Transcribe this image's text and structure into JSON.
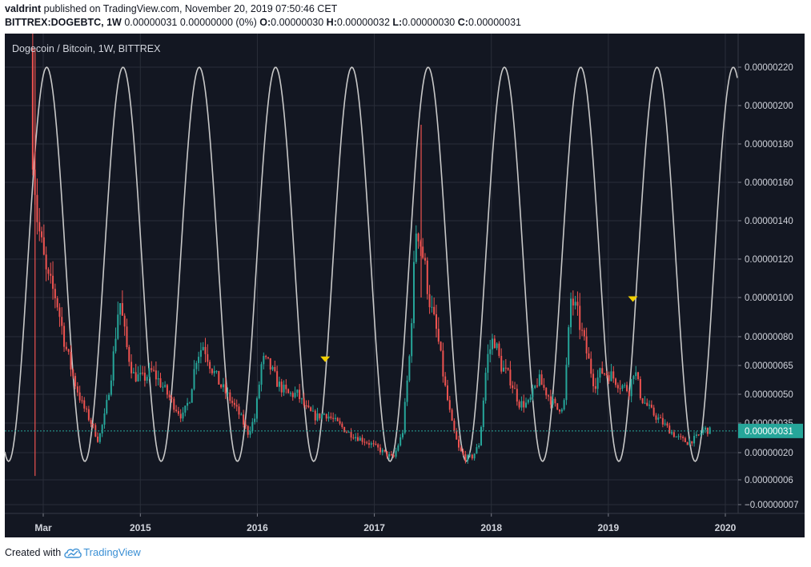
{
  "header": {
    "author": "valdrint",
    "published_text": "published on TradingView.com, November 20, 2019 07:50:46 CET",
    "symbol": "BITTREX:DOGEBTC",
    "interval": ", 1W",
    "last": "0.00000031",
    "change": "0.00000000 (0%)",
    "o_label": "O:",
    "o_value": "0.00000030",
    "h_label": "H:",
    "h_value": "0.00000032",
    "l_label": "L:",
    "l_value": "0.00000030",
    "c_label": "C:",
    "c_value": "0.00000031"
  },
  "footer": {
    "created_with": "Created with",
    "brand": "TradingView"
  },
  "colors": {
    "background": "#131722",
    "grid": "#2a2e39",
    "up": "#26a69a",
    "down": "#ef5350",
    "cycle": "#c8c8c8",
    "marker": "#f2d000",
    "price_label": "#26a69a"
  },
  "chart_data": {
    "type": "candlestick",
    "title": "Dogecoin / Bitcoin, 1W, BITTREX",
    "x_start": "2014-02",
    "x_end": "2020-01",
    "x_ticks": [
      {
        "label": "Mar",
        "t": 2014.17
      },
      {
        "label": "2015",
        "t": 2015.0
      },
      {
        "label": "2016",
        "t": 2016.0
      },
      {
        "label": "2017",
        "t": 2017.0
      },
      {
        "label": "2018",
        "t": 2018.0
      },
      {
        "label": "2019",
        "t": 2019.0
      },
      {
        "label": "2020",
        "t": 2020.0
      }
    ],
    "y_ticks": [
      {
        "label": "0.00000220",
        "v": 220
      },
      {
        "label": "0.00000200",
        "v": 200
      },
      {
        "label": "0.00000180",
        "v": 180
      },
      {
        "label": "0.00000160",
        "v": 160
      },
      {
        "label": "0.00000140",
        "v": 140
      },
      {
        "label": "0.00000120",
        "v": 120
      },
      {
        "label": "0.00000100",
        "v": 100
      },
      {
        "label": "0.00000080",
        "v": 80
      },
      {
        "label": "0.00000065",
        "v": 65
      },
      {
        "label": "0.00000050",
        "v": 50
      },
      {
        "label": "0.00000035",
        "v": 35
      },
      {
        "label": "0.00000020",
        "v": 20
      },
      {
        "label": "0.00000006",
        "v": 6
      },
      {
        "label": "−0.00000007",
        "v": -7
      }
    ],
    "last_price": {
      "label": "0.00000031",
      "v": 31
    },
    "price_path": [
      [
        2014.08,
        230
      ],
      [
        2014.1,
        175
      ],
      [
        2014.14,
        140
      ],
      [
        2014.18,
        125
      ],
      [
        2014.22,
        110
      ],
      [
        2014.3,
        100
      ],
      [
        2014.38,
        75
      ],
      [
        2014.45,
        58
      ],
      [
        2014.52,
        45
      ],
      [
        2014.6,
        35
      ],
      [
        2014.66,
        26
      ],
      [
        2014.72,
        40
      ],
      [
        2014.78,
        65
      ],
      [
        2014.84,
        100
      ],
      [
        2014.9,
        75
      ],
      [
        2014.96,
        60
      ],
      [
        2015.04,
        58
      ],
      [
        2015.12,
        62
      ],
      [
        2015.2,
        55
      ],
      [
        2015.3,
        45
      ],
      [
        2015.38,
        38
      ],
      [
        2015.44,
        48
      ],
      [
        2015.5,
        70
      ],
      [
        2015.56,
        76
      ],
      [
        2015.62,
        65
      ],
      [
        2015.7,
        55
      ],
      [
        2015.78,
        48
      ],
      [
        2015.86,
        40
      ],
      [
        2015.94,
        30
      ],
      [
        2016.0,
        38
      ],
      [
        2016.06,
        68
      ],
      [
        2016.12,
        65
      ],
      [
        2016.2,
        55
      ],
      [
        2016.28,
        50
      ],
      [
        2016.36,
        50
      ],
      [
        2016.44,
        42
      ],
      [
        2016.52,
        38
      ],
      [
        2016.6,
        40
      ],
      [
        2016.7,
        35
      ],
      [
        2016.8,
        30
      ],
      [
        2016.9,
        27
      ],
      [
        2017.0,
        24
      ],
      [
        2017.1,
        20
      ],
      [
        2017.18,
        17
      ],
      [
        2017.26,
        30
      ],
      [
        2017.32,
        70
      ],
      [
        2017.38,
        140
      ],
      [
        2017.44,
        120
      ],
      [
        2017.5,
        95
      ],
      [
        2017.56,
        80
      ],
      [
        2017.62,
        55
      ],
      [
        2017.68,
        35
      ],
      [
        2017.74,
        22
      ],
      [
        2017.8,
        17
      ],
      [
        2017.86,
        18
      ],
      [
        2017.92,
        25
      ],
      [
        2017.98,
        68
      ],
      [
        2018.04,
        80
      ],
      [
        2018.1,
        65
      ],
      [
        2018.18,
        58
      ],
      [
        2018.26,
        45
      ],
      [
        2018.34,
        45
      ],
      [
        2018.42,
        58
      ],
      [
        2018.5,
        50
      ],
      [
        2018.58,
        42
      ],
      [
        2018.64,
        45
      ],
      [
        2018.7,
        100
      ],
      [
        2018.76,
        90
      ],
      [
        2018.84,
        70
      ],
      [
        2018.9,
        55
      ],
      [
        2018.96,
        62
      ],
      [
        2019.04,
        60
      ],
      [
        2019.12,
        55
      ],
      [
        2019.2,
        52
      ],
      [
        2019.24,
        64
      ],
      [
        2019.3,
        48
      ],
      [
        2019.4,
        40
      ],
      [
        2019.5,
        34
      ],
      [
        2019.6,
        28
      ],
      [
        2019.7,
        25
      ],
      [
        2019.78,
        28
      ],
      [
        2019.84,
        32
      ],
      [
        2019.88,
        31
      ]
    ],
    "wick_spikes": [
      {
        "t": 2014.1,
        "high": 230,
        "low": 8
      },
      {
        "t": 2017.4,
        "high": 190,
        "low": 100
      },
      {
        "t": 2015.8,
        "high": 0,
        "low": 0
      }
    ],
    "cycle_line": {
      "name": "",
      "min": 15.5,
      "max": 220,
      "first_peak": 2014.2,
      "period_years": 0.652
    },
    "markers": [
      {
        "t": 2016.58,
        "v": 68,
        "shape": "triangle-down"
      },
      {
        "t": 2019.21,
        "v": 99,
        "shape": "triangle-down"
      }
    ],
    "ylim": [
      -11,
      232
    ],
    "grid": true,
    "legend": "none"
  }
}
